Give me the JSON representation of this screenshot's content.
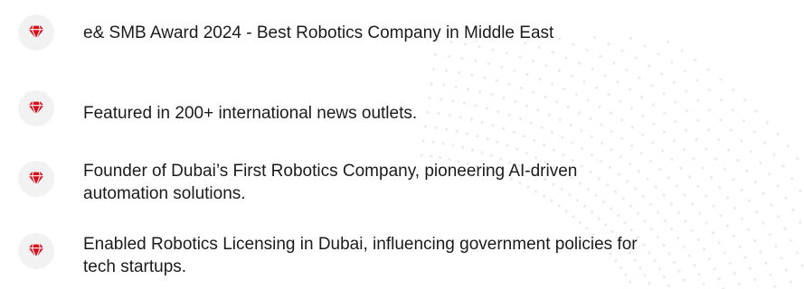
{
  "achievements": [
    {
      "icon": "diamond-icon",
      "text": "e& SMB Award 2024 - Best Robotics Company in Middle East"
    },
    {
      "icon": "diamond-icon",
      "text": "Featured in 200+ international news outlets."
    },
    {
      "icon": "diamond-icon",
      "text": "Founder of Dubai’s First Robotics Company, pioneering AI-driven\nautomation solutions."
    },
    {
      "icon": "diamond-icon",
      "text": "Enabled Robotics Licensing in Dubai, influencing government policies for\ntech startups."
    }
  ],
  "colors": {
    "accent": "#e30613",
    "badge_bg": "#f2f2f2",
    "text": "#1b1b1b"
  }
}
